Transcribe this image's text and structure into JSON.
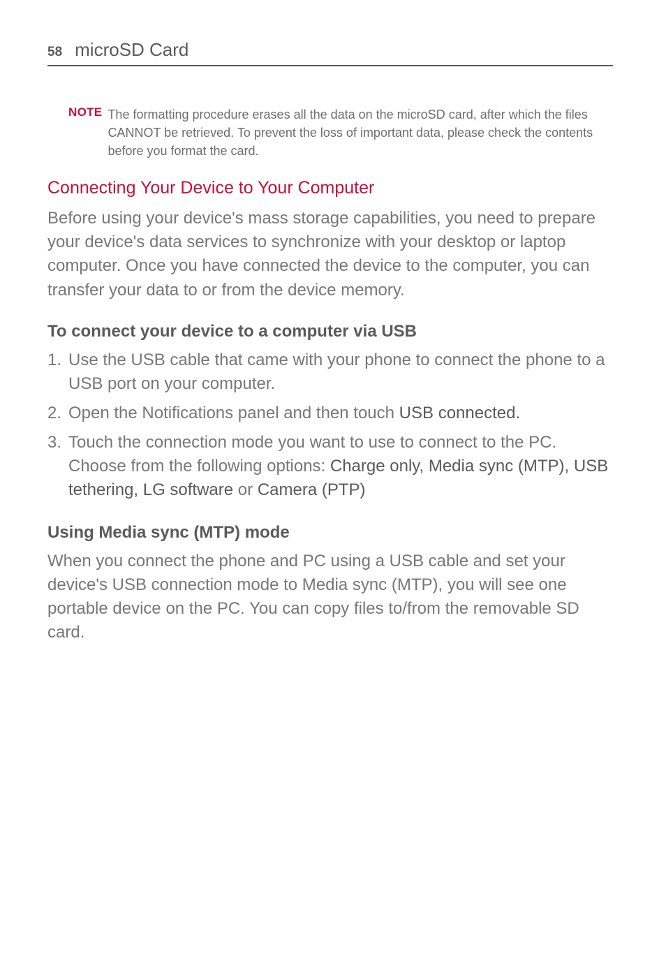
{
  "header": {
    "page_number": "58",
    "title": "microSD Card"
  },
  "note": {
    "label": "NOTE",
    "text": "The formatting procedure erases all the data on the microSD card, after which the files CANNOT be retrieved. To prevent the loss of important data, please check the contents before you format the card."
  },
  "section1": {
    "heading": "Connecting Your Device to Your Computer",
    "paragraph": "Before using your device's mass storage capabilities, you need to prepare your device's data services to synchronize with your desktop or laptop computer. Once you have connected the device to the computer, you can transfer your data to or from the device memory."
  },
  "section2": {
    "heading": "To connect your device to a computer via USB",
    "items": {
      "n1": "1.",
      "t1": "Use the USB cable that came with your phone to connect the phone to a USB port on your computer.",
      "n2": "2.",
      "t2a": "Open the Notifications panel and then touch ",
      "t2b": "USB connected.",
      "n3": "3.",
      "t3a": "Touch the connection mode you want to use to connect to the PC. Choose from the following options: ",
      "t3b": "Charge only, Media sync (MTP), USB tethering, LG software",
      "t3c": " or ",
      "t3d": "Camera (PTP)"
    }
  },
  "section3": {
    "heading": "Using Media sync (MTP) mode",
    "paragraph": "When you connect the phone and PC using a USB cable and set your device's USB connection mode to Media sync (MTP), you will see one portable device on the PC. You can copy files to/from the removable SD card."
  }
}
